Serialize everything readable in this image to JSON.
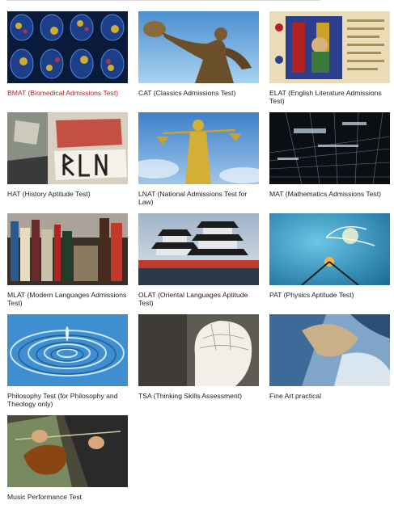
{
  "tests": [
    {
      "label": "BMAT (Biomedical Admissions Test)",
      "active": true,
      "icon": "brain-scan-image"
    },
    {
      "label": "CAT (Classics Admissions Test)",
      "active": false,
      "icon": "discus-thrower-statue-image"
    },
    {
      "label": "ELAT (English Literature Admissions Test)",
      "active": false,
      "icon": "illuminated-manuscript-image"
    },
    {
      "label": "HAT (History Aptitude Test)",
      "active": false,
      "icon": "berlin-wall-graffiti-image"
    },
    {
      "label": "LNAT (National Admissions Test for Law)",
      "active": false,
      "icon": "lady-justice-statue-image"
    },
    {
      "label": "MAT (Mathematics Admissions Test)",
      "active": false,
      "icon": "digital-grid-image"
    },
    {
      "label": "MLAT (Modern Languages Admissions Test)",
      "active": false,
      "icon": "bookshelf-image"
    },
    {
      "label": "OLAT (Oriental Languages Aptitude Test)",
      "active": false,
      "icon": "japanese-castle-image"
    },
    {
      "label": "PAT (Physics Aptitude Test)",
      "active": false,
      "icon": "light-bulb-filament-image"
    },
    {
      "label": "Philosophy Test (for Philosophy and Theology only)",
      "active": false,
      "icon": "water-ripple-image"
    },
    {
      "label": "TSA (Thinking Skills Assessment)",
      "active": false,
      "icon": "phrenology-head-image"
    },
    {
      "label": "Fine Art practical",
      "active": false,
      "icon": "abstract-painting-image"
    },
    {
      "label": "Music Performance Test",
      "active": false,
      "icon": "violin-player-image"
    }
  ],
  "colors": {
    "active_link": "#b3262b",
    "text": "#222222"
  }
}
